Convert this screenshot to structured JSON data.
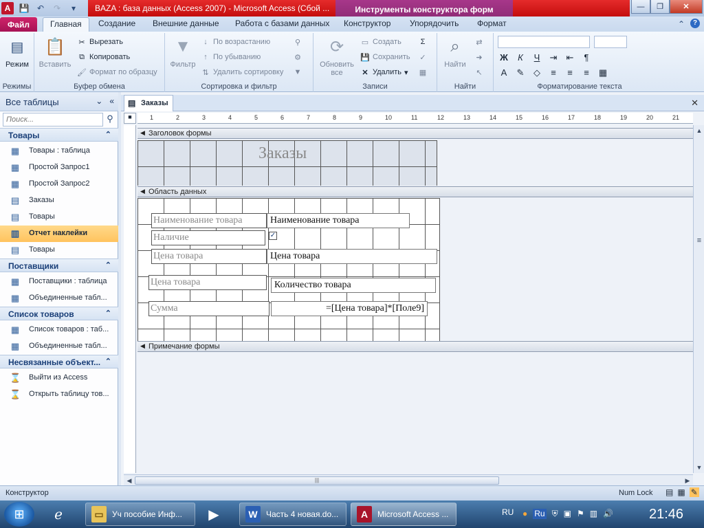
{
  "titlebar": {
    "title": "BAZA : база данных (Access 2007) - Microsoft Access (Сбой ...",
    "context_tab": "Инструменты конструктора форм",
    "min": "—",
    "max": "❐",
    "close": "✕"
  },
  "ribbon_tabs": {
    "file": "Файл",
    "home": "Главная",
    "create": "Создание",
    "external": "Внешние данные",
    "dbtools": "Работа с базами данных",
    "design": "Конструктор",
    "arrange": "Упорядочить",
    "format": "Формат"
  },
  "ribbon": {
    "views": {
      "label": "Режимы",
      "mode": "Режим"
    },
    "clipboard": {
      "label": "Буфер обмена",
      "paste": "Вставить",
      "cut": "Вырезать",
      "copy": "Копировать",
      "painter": "Формат по образцу"
    },
    "sort": {
      "label": "Сортировка и фильтр",
      "filter": "Фильтр",
      "asc": "По возрастанию",
      "desc": "По убыванию",
      "clear": "Удалить сортировку"
    },
    "records": {
      "label": "Записи",
      "refresh": "Обновить все",
      "new": "Создать",
      "save": "Сохранить",
      "delete": "Удалить"
    },
    "find": {
      "label": "Найти",
      "find": "Найти"
    },
    "text": {
      "label": "Форматирование текста",
      "bold": "Ж",
      "italic": "К",
      "underline": "Ч",
      "fontcolor": "A"
    }
  },
  "nav": {
    "header": "Все таблицы",
    "search_placeholder": "Поиск...",
    "groups": [
      {
        "name": "Товары",
        "items": [
          "Товары : таблица",
          "Простой Запрос1",
          "Простой Запрос2",
          "Заказы",
          "Товары",
          "Отчет наклейки",
          "Товары"
        ]
      },
      {
        "name": "Поставщики",
        "items": [
          "Поставщики : таблица",
          "Объединенные табл..."
        ]
      },
      {
        "name": "Список товаров",
        "items": [
          "Список товаров : таб...",
          "Объединенные табл..."
        ]
      },
      {
        "name": "Несвязанные объект...",
        "items": [
          "Выйти из Access",
          "Открыть таблицу тов..."
        ]
      }
    ]
  },
  "document": {
    "tab": "Заказы",
    "ruler_numbers": [
      "1",
      "2",
      "3",
      "4",
      "5",
      "6",
      "7",
      "8",
      "9",
      "10",
      "11",
      "12",
      "13",
      "14",
      "15",
      "16",
      "17",
      "18",
      "19",
      "20",
      "21"
    ],
    "sections": {
      "header": "Заголовок формы",
      "detail": "Область данных",
      "footer": "Примечание формы"
    },
    "form_title": "Заказы",
    "labels": [
      "Наименование товара",
      "Наличие",
      "Цена товара",
      "Цена товара",
      "Сумма"
    ],
    "fields": [
      "Наименование товара",
      "Цена товара",
      "Количество товара",
      "=[Цена товара]*[Поле9]"
    ],
    "checkbox_mark": "✓"
  },
  "status": {
    "mode": "Конструктор",
    "numlock": "Num Lock"
  },
  "taskbar": {
    "tasks": [
      "Уч пособие Инф...",
      "Часть 4 новая.do...",
      "Microsoft Access ..."
    ],
    "lang": "RU",
    "ime": "Ru",
    "clock": "21:46"
  }
}
